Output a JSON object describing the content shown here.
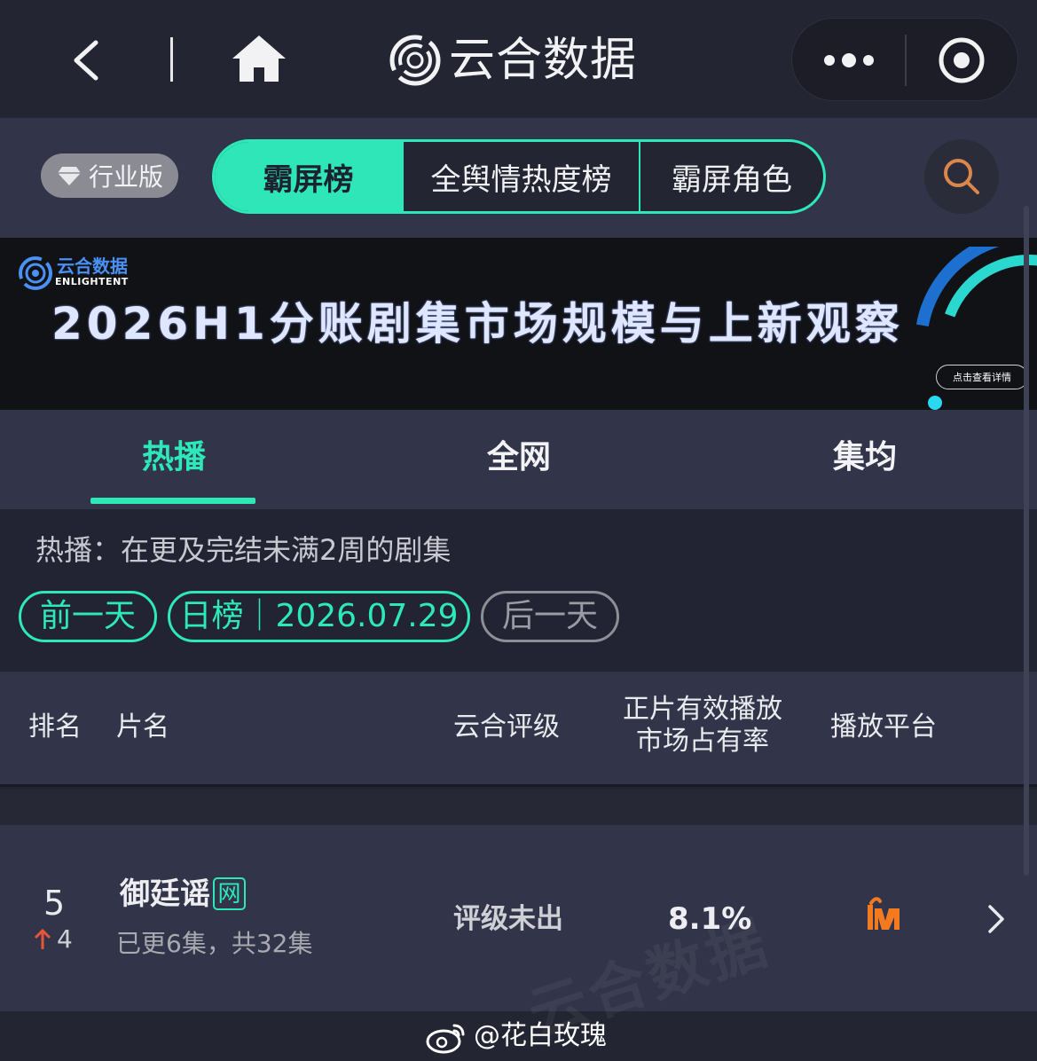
{
  "nav": {
    "title": "云合数据",
    "icons": [
      "back-arrow",
      "home",
      "logo",
      "more-dots",
      "target-circle"
    ]
  },
  "subbar": {
    "edition_label": "行业版",
    "tabs": [
      "霸屏榜",
      "全舆情热度榜",
      "霸屏角色"
    ],
    "active_tab": "霸屏榜"
  },
  "banner": {
    "brand_cn": "云合数据",
    "brand_en": "ENLIGHTENT",
    "title": "2026H1分账剧集市场规模与上新观察",
    "detail_button": "点击查看详情"
  },
  "categories": {
    "items": [
      "热播",
      "全网",
      "集均"
    ],
    "active": "热播"
  },
  "description": "热播：在更及完结未满2周的剧集",
  "date_controls": {
    "prev": "前一天",
    "current": "日榜｜2026.07.29",
    "next": "后一天"
  },
  "table": {
    "headers": {
      "rank": "排名",
      "title": "片名",
      "rating": "云合评级",
      "share_line1": "正片有效播放",
      "share_line2": "市场占有率",
      "platform": "播放平台"
    },
    "rows": [
      {
        "rank": "5",
        "rank_change": "4",
        "rank_change_direction": "up",
        "title": "御廷谣",
        "badge": "网",
        "episodes": "已更6集，共32集",
        "rating": "评级未出",
        "share": "8.1%",
        "platform_icon": "mango-tv-icon"
      }
    ]
  },
  "watermark": {
    "text": "@花白玫瑰",
    "background_text": "云合数据"
  },
  "colors": {
    "accent": "#2de8b8",
    "background": "#222433",
    "panel": "#323549",
    "brand_blue": "#4a90f5",
    "platform_orange": "#f47a1f",
    "up_arrow": "#e8543a"
  }
}
